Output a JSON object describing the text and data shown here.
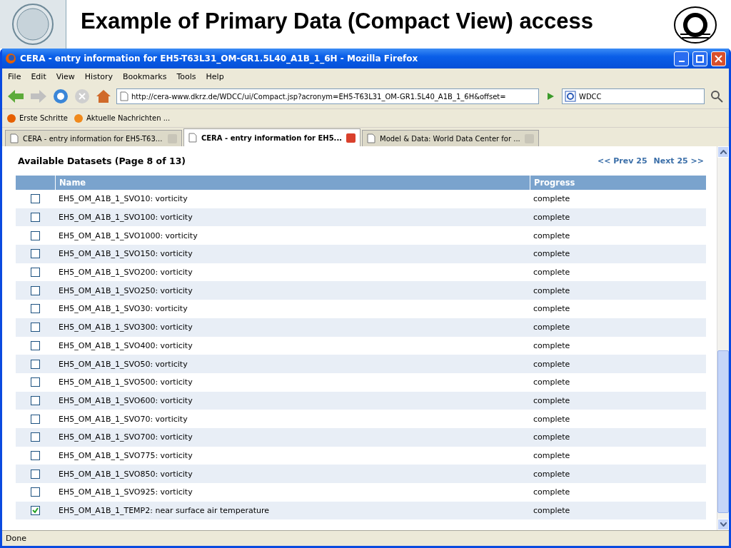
{
  "slide": {
    "title_line_1": "Example of Primary Data (Compact View) access"
  },
  "window": {
    "title": "CERA - entry information for EH5-T63L31_OM-GR1.5L40_A1B_1_6H - Mozilla Firefox"
  },
  "menu": [
    "File",
    "Edit",
    "View",
    "History",
    "Bookmarks",
    "Tools",
    "Help"
  ],
  "address_bar": {
    "value": "http://cera-www.dkrz.de/WDCC/ui/Compact.jsp?acronym=EH5-T63L31_OM-GR1.5L40_A1B_1_6H&offset="
  },
  "search": {
    "value": "WDCC"
  },
  "bookmarks": [
    "Erste Schritte",
    "Aktuelle Nachrichten ..."
  ],
  "tabs": [
    {
      "label": "CERA - entry information for EH5-T63...",
      "selected": false
    },
    {
      "label": "CERA - entry information for EH5...",
      "selected": true
    },
    {
      "label": "Model & Data: World Data Center for ...",
      "selected": false
    }
  ],
  "page": {
    "heading": "Available Datasets (Page 8 of 13)",
    "prev": "<< Prev 25",
    "next": "Next 25 >>"
  },
  "table": {
    "columns": [
      "Name",
      "Progress"
    ],
    "rows": [
      {
        "name": "EH5_OM_A1B_1_SVO10: vorticity",
        "progress": "complete",
        "checked": false
      },
      {
        "name": "EH5_OM_A1B_1_SVO100: vorticity",
        "progress": "complete",
        "checked": false
      },
      {
        "name": "EH5_OM_A1B_1_SVO1000: vorticity",
        "progress": "complete",
        "checked": false
      },
      {
        "name": "EH5_OM_A1B_1_SVO150: vorticity",
        "progress": "complete",
        "checked": false
      },
      {
        "name": "EH5_OM_A1B_1_SVO200: vorticity",
        "progress": "complete",
        "checked": false
      },
      {
        "name": "EH5_OM_A1B_1_SVO250: vorticity",
        "progress": "complete",
        "checked": false
      },
      {
        "name": "EH5_OM_A1B_1_SVO30: vorticity",
        "progress": "complete",
        "checked": false
      },
      {
        "name": "EH5_OM_A1B_1_SVO300: vorticity",
        "progress": "complete",
        "checked": false
      },
      {
        "name": "EH5_OM_A1B_1_SVO400: vorticity",
        "progress": "complete",
        "checked": false
      },
      {
        "name": "EH5_OM_A1B_1_SVO50: vorticity",
        "progress": "complete",
        "checked": false
      },
      {
        "name": "EH5_OM_A1B_1_SVO500: vorticity",
        "progress": "complete",
        "checked": false
      },
      {
        "name": "EH5_OM_A1B_1_SVO600: vorticity",
        "progress": "complete",
        "checked": false
      },
      {
        "name": "EH5_OM_A1B_1_SVO70: vorticity",
        "progress": "complete",
        "checked": false
      },
      {
        "name": "EH5_OM_A1B_1_SVO700: vorticity",
        "progress": "complete",
        "checked": false
      },
      {
        "name": "EH5_OM_A1B_1_SVO775: vorticity",
        "progress": "complete",
        "checked": false
      },
      {
        "name": "EH5_OM_A1B_1_SVO850: vorticity",
        "progress": "complete",
        "checked": false
      },
      {
        "name": "EH5_OM_A1B_1_SVO925: vorticity",
        "progress": "complete",
        "checked": false
      },
      {
        "name": "EH5_OM_A1B_1_TEMP2: near surface air temperature",
        "progress": "complete",
        "checked": true
      }
    ]
  },
  "status_bar": "Done"
}
